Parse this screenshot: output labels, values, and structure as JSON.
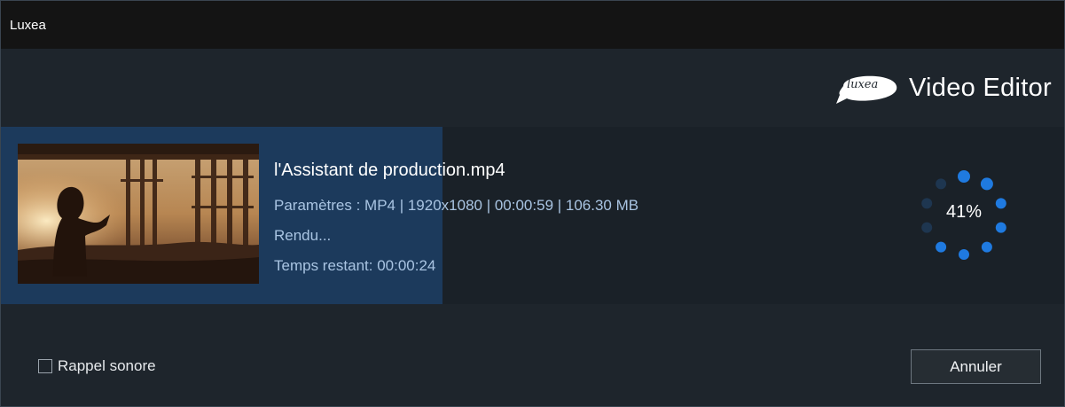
{
  "window": {
    "title": "Luxea"
  },
  "brand": {
    "logo_text": "luxea",
    "product_name": "Video Editor"
  },
  "render": {
    "file_name": "l'Assistant de production.mp4",
    "params": "Paramètres : MP4 | 1920x1080 | 00:00:59 | 106.30 MB",
    "status": "Rendu...",
    "time_remaining": "Temps restant: 00:00:24",
    "progress_percent": 41,
    "progress_label": "41%"
  },
  "footer": {
    "sound_alert_label": "Rappel sonore",
    "sound_alert_checked": false,
    "cancel_label": "Annuler"
  },
  "colors": {
    "accent": "#1f7ae0",
    "progress_fill": "#1c3a5c",
    "meta_text": "#a9c4e2"
  }
}
